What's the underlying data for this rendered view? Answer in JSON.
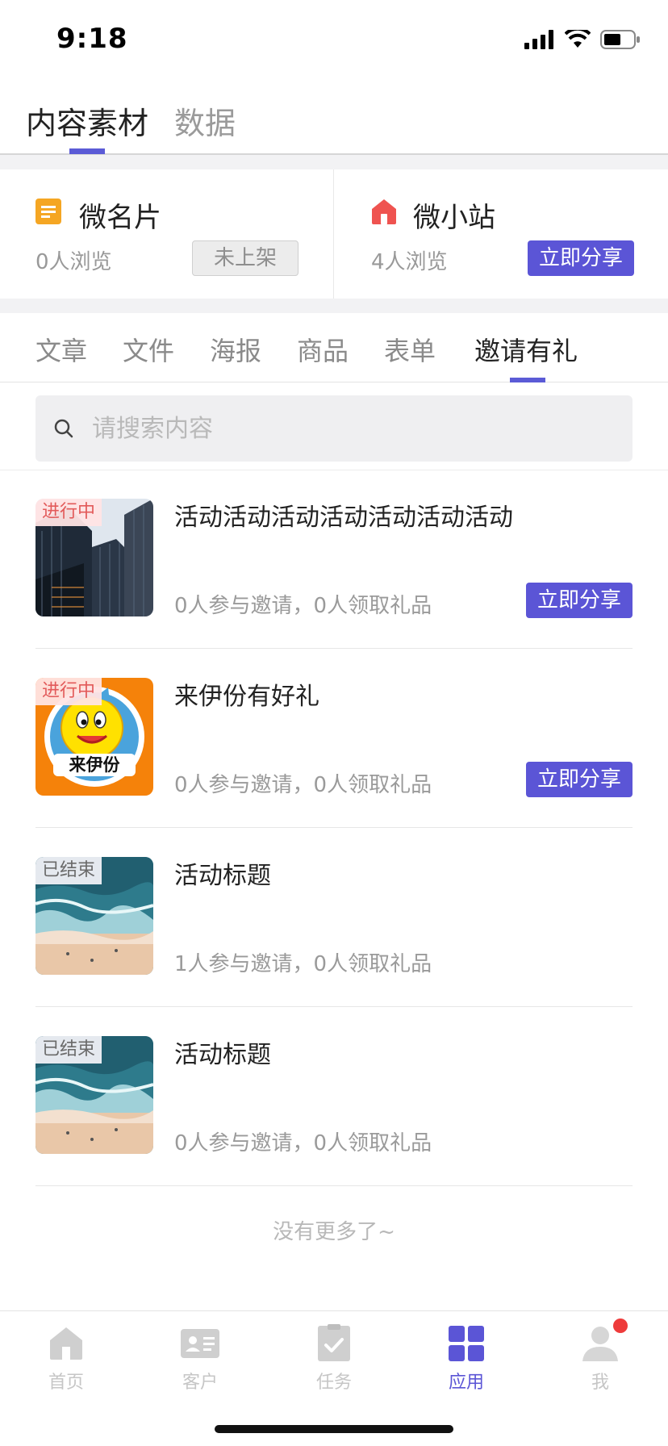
{
  "status_bar": {
    "time": "9:18"
  },
  "top_tabs": [
    {
      "label": "内容素材",
      "active": true
    },
    {
      "label": "数据",
      "active": false
    }
  ],
  "cards": [
    {
      "title": "微名片",
      "views": "0人浏览",
      "button": "未上架",
      "icon": "document-icon",
      "icon_color": "#f5a623"
    },
    {
      "title": "微小站",
      "views": "4人浏览",
      "button": "立即分享",
      "icon": "house-icon",
      "icon_color": "#ef5350"
    }
  ],
  "category_tabs": [
    {
      "label": "文章"
    },
    {
      "label": "文件"
    },
    {
      "label": "海报"
    },
    {
      "label": "商品"
    },
    {
      "label": "表单"
    },
    {
      "label": "邀请有礼",
      "active": true
    }
  ],
  "search": {
    "placeholder": "请搜索内容"
  },
  "items": [
    {
      "status": "进行中",
      "title": "活动活动活动活动活动活动活动",
      "stats": "0人参与邀请，0人领取礼品",
      "share": "立即分享",
      "thumb": "buildings"
    },
    {
      "status": "进行中",
      "title": "来伊份有好礼",
      "stats": "0人参与邀请，0人领取礼品",
      "share": "立即分享",
      "thumb": "laiyifen-logo",
      "logo_text": "来伊份"
    },
    {
      "status": "已结束",
      "title": "活动标题",
      "stats": "1人参与邀请，0人领取礼品",
      "thumb": "beach"
    },
    {
      "status": "已结束",
      "title": "活动标题",
      "stats": "0人参与邀请，0人领取礼品",
      "thumb": "beach"
    }
  ],
  "footer_text": "没有更多了~",
  "bottom_nav": [
    {
      "label": "首页",
      "icon": "home-icon"
    },
    {
      "label": "客户",
      "icon": "contact-card-icon"
    },
    {
      "label": "任务",
      "icon": "clipboard-check-icon"
    },
    {
      "label": "应用",
      "icon": "apps-grid-icon",
      "active": true
    },
    {
      "label": "我",
      "icon": "person-icon",
      "has_dot": true
    }
  ],
  "colors": {
    "accent": "#5b55d6",
    "active_badge": "#e25a5a",
    "notification": "#ee3b3b"
  }
}
